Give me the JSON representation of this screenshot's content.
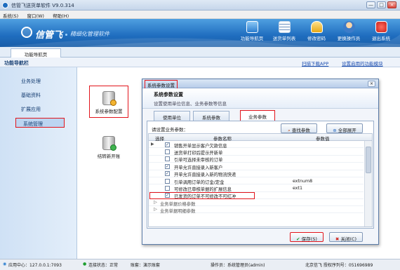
{
  "app": {
    "title": "信管飞送货单软件 V9.0.314"
  },
  "menu": [
    "系统(S)",
    "窗口(W)",
    "帮助(H)"
  ],
  "window_controls": {
    "min": "—",
    "max": "□",
    "close": "×"
  },
  "banner": {
    "logo_text": "信管飞",
    "slogan": "精细化管理软件",
    "toolbar": [
      "功能导航页",
      "送货单列表",
      "修改密码",
      "更换操作员",
      "退出系统"
    ]
  },
  "tab_strip": {
    "active_tab": "功能导航页"
  },
  "nav": {
    "title": "功能导航栏",
    "link_download": "扫描下载APP",
    "link_setup": "设置启用的功能模块"
  },
  "sidebar": {
    "items": [
      "业务处理",
      "基础资料",
      "扩展应用",
      "系统管理"
    ],
    "active": "系统管理"
  },
  "content": {
    "icons": [
      "系统参数配置",
      "结转新开账"
    ]
  },
  "dialog": {
    "title": "系统参数设置",
    "header_title": "系统参数设置",
    "header_sub": "设置使用单位信息、业务参数等信息",
    "tabs": [
      "使用单位",
      "系统参数",
      "业务参数"
    ],
    "active_tab": "业务参数",
    "prompt": "请设置业务参数：",
    "find_button": "查找参数",
    "expand_button": "全部展开",
    "columns": [
      "选择",
      "参数名称",
      "参数值"
    ],
    "rows": [
      {
        "checked": true,
        "name": "销售开单显示客户欠款信息",
        "value": ""
      },
      {
        "checked": false,
        "name": "送货单打印后提示开新单",
        "value": ""
      },
      {
        "checked": false,
        "name": "引单可选择未审核的订单",
        "value": ""
      },
      {
        "checked": true,
        "name": "开单允许直接录入新客户",
        "value": ""
      },
      {
        "checked": true,
        "name": "开单允许直接录入新的物流快递",
        "value": ""
      },
      {
        "checked": false,
        "name": "引单调用订单的订金/定金",
        "value": "extnum8"
      },
      {
        "checked": false,
        "name": "可修改已审核单据的扩展信息",
        "value": "ext1"
      },
      {
        "checked": true,
        "name": "已发货的订单不可修改不可红冲",
        "value": ""
      }
    ],
    "groups": [
      "业务单据价格参数",
      "业务单据明细参数"
    ],
    "save_button": "保存(S)",
    "close_button": "关闭(C)"
  },
  "status": {
    "app_center": "应用中心：127.0.0.1:7093",
    "connection": "连接状态：正常",
    "account": "账套：演示账套",
    "operator": "操作员：系统管理员(admin)",
    "company": "北京信飞 授权序列号：051696989"
  },
  "colors": {
    "accent": "#1f6dbf",
    "highlight": "#e2141b"
  }
}
